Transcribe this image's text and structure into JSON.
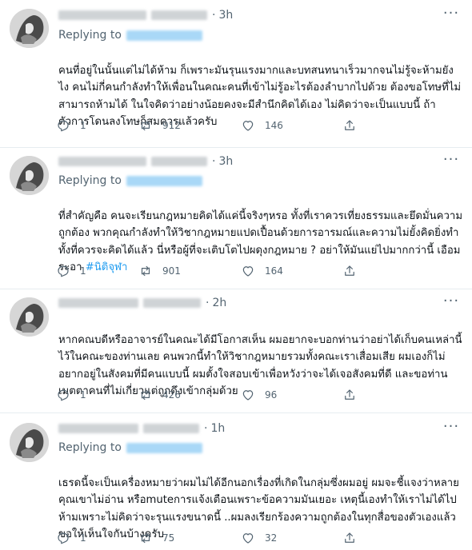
{
  "tweets": [
    {
      "time": "3h",
      "replying_to": "Replying to",
      "text": "คนที่อยู่ในนั้นแต่ไม่ได้ห้าม ก็เพราะมันรุนแรงมากและบทสนทนาเร็วมากจนไม่รู้จะห้ามยังไง คนไม่กี่คนกำลังทำให้เพื่อนในคณะคนที่เข้าไม่รู้อะไรต้องลำบากไปด้วย ต้องขอโทษที่ไม่สามารถห้ามได้ ในใจคิดว่าอย่างน้อยคงจะมีสำนึกคิดได้เอง ไม่คิดว่าจะเป็นแบบนี้ ถ้าตัวการโดนลงโทษก็สมควรแล้วครับ",
      "hashtag": "",
      "replies": "1",
      "retweets": "912",
      "likes": "146"
    },
    {
      "time": "3h",
      "replying_to": "Replying to",
      "text": "ที่สำคัญคือ คนจะเรียนกฎหมายคิดได้แค่นี้จริงๆหรอ ทั้งที่เราควรเที่ยงธรรมและยึดมั่นความถูกต้อง พวกคุณกำลังทำให้วิชากฎหมายแปดเปื้อนด้วยการอารมณ์และความไม่ยั้งคิดยิ่งทำทั้งที่ควรจะคิดได้แล้ว นี่หรือผู้ที่จะเติบโตไปผดุงกฎหมาย ? อย่าให้มันแย่ไปมากกว่านี้ เอือมระอา ",
      "hashtag": "#นิติจุฬา",
      "replies": "1",
      "retweets": "901",
      "likes": "164"
    },
    {
      "time": "2h",
      "replying_to": "",
      "text": "หากคณบดีหรืออาจารย์ในคณะได้มีโอกาสเห็น ผมอยากจะบอกท่านว่าอย่าได้เก็บคนเหล่านี้ไว้ในคณะของท่านเลย คนพวกนี้ทำให้วิชากฎหมายรวมทั้งคณะเราเสื่อมเสีย ผมเองก็ไม่อยากอยู่ในสังคมที่มีคนแบบนี้ ผมตั้งใจสอบเข้าเพื่อหวังว่าจะได้เจอสังคมที่ดี และขอท่านเมตตาคนที่ไม่เกี่ยวแต่ถูกดึงเข้ากลุ่มด้วย",
      "hashtag": "",
      "replies": "1",
      "retweets": "426",
      "likes": "96"
    },
    {
      "time": "1h",
      "replying_to": "Replying to",
      "text": "เธรดนี้จะเป็นเครื่องหมายว่าผมไม่ได้อีกนอกเรื่องที่เกิดในกลุ่มซึ่งผมอยู่ ผมจะชี้แจงว่าหลายคุณเขาไม่อ่าน หรือmuteการแจ้งเตือนเพราะข้อความมันเยอะ เหตุนี้เองทำให้เราไม่ได้ไปห้ามเพราะไม่คิดว่าจะรุนแรงขนาดนี้ ..ผมลงเรียกร้องความถูกต้องในทุกสื่อของตัวเองแล้ว ขอให้เห็นใจกันบ้างครับ",
      "hashtag": "",
      "replies": "1",
      "retweets": "75",
      "likes": "32"
    }
  ],
  "icons": {
    "reply": "reply-icon",
    "retweet": "retweet-icon",
    "like": "like-icon",
    "share": "share-icon",
    "more": "more-options-icon"
  },
  "colors": {
    "accent": "#1d9bf0",
    "muted": "#536471",
    "text": "#0f1419",
    "divider": "#e6ecf0"
  }
}
